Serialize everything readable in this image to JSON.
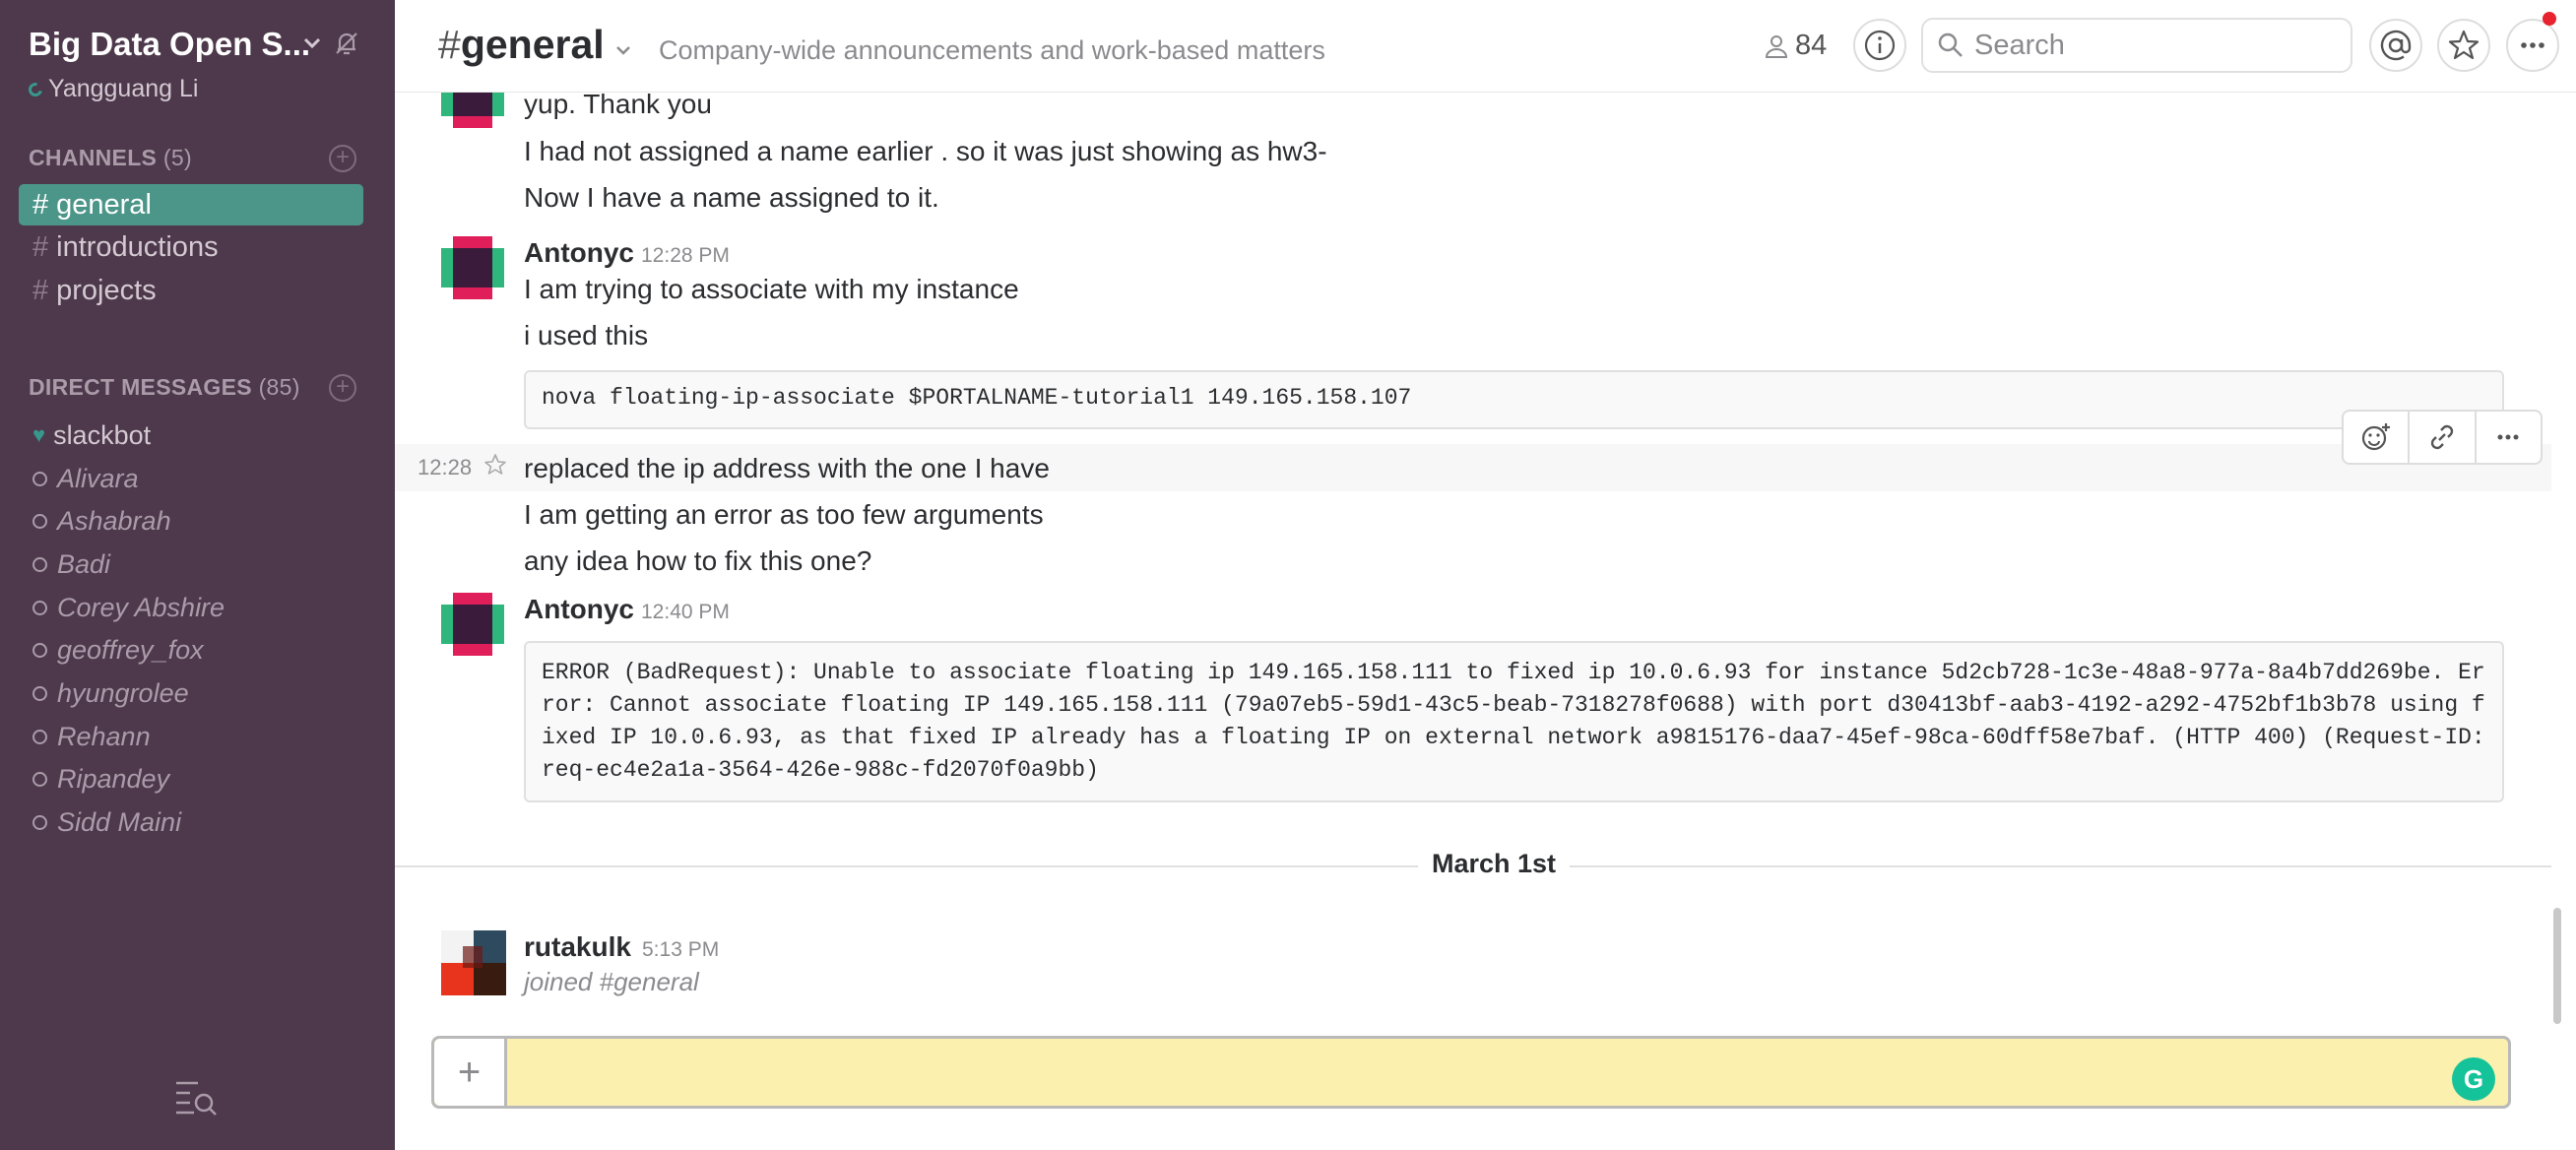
{
  "team": {
    "name": "Big Data Open S...",
    "user": "Yangguang Li"
  },
  "sidebar": {
    "channels_header": "CHANNELS",
    "channels_count": "(5)",
    "channels": [
      {
        "name": "general",
        "active": true
      },
      {
        "name": "introductions",
        "active": false
      },
      {
        "name": "projects",
        "active": false
      }
    ],
    "dm_header": "DIRECT MESSAGES",
    "dm_count": "(85)",
    "dms": [
      "slackbot",
      "Alivara",
      "Ashabrah",
      "Badi",
      "Corey Abshire",
      "geoffrey_fox",
      "hyungrolee",
      "Rehann",
      "Ripandey",
      "Sidd Maini"
    ]
  },
  "header": {
    "hash": "#",
    "channel": "general",
    "purpose": "Company-wide announcements and work-based matters",
    "members": "84",
    "search_placeholder": "Search"
  },
  "messages": {
    "m1": "yup. Thank you",
    "m2": "I had not assigned a name earlier . so it was just showing as hw3-",
    "m3": "Now I have a name assigned to it.",
    "a1_author": "Antonyc",
    "a1_time": "12:28 PM",
    "a1_m1": "I am trying to associate with my instance",
    "a1_m2": "i used this",
    "a1_code": "nova floating-ip-associate $PORTALNAME-tutorial1 149.165.158.107",
    "hover_time": "12:28",
    "a1_m3": "replaced the ip address with the one I have",
    "a1_m4": "I am getting an error as too few arguments",
    "a1_m5": "any idea how to fix this one?",
    "a2_author": "Antonyc",
    "a2_time": "12:40 PM",
    "a2_code": "ERROR (BadRequest): Unable to associate floating ip 149.165.158.111 to fixed ip 10.0.6.93 for instance 5d2cb728-1c3e-48a8-977a-8a4b7dd269be. Error: Cannot associate floating IP 149.165.158.111 (79a07eb5-59d1-43c5-beab-7318278f0688) with port d30413bf-aab3-4192-a292-4752bf1b3b78 using fixed IP 10.0.6.93, as that fixed IP already has a floating IP on external network a9815176-daa7-45ef-98ca-60dff58e7baf. (HTTP 400) (Request-ID: req-ec4e2a1a-3564-426e-988c-fd2070f0a9bb)",
    "day_divider": "March 1st",
    "a3_author": "rutakulk",
    "a3_time": "5:13 PM",
    "a3_m1": "joined #general"
  },
  "composer": {
    "plus": "+",
    "value": ""
  },
  "colors": {
    "sidebar_bg": "#4d394b",
    "active_channel": "#4c9689",
    "composer_bg": "#fbf0ad",
    "notification": "#e8232f"
  }
}
